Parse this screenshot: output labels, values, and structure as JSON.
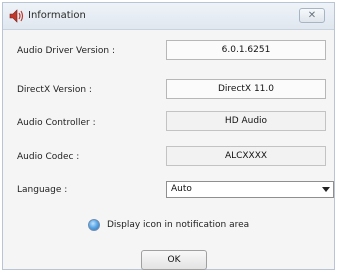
{
  "window": {
    "title": "Information",
    "close_label": "✕"
  },
  "fields": {
    "audio_driver_version": {
      "label": "Audio Driver Version :",
      "value": "6.0.1.6251"
    },
    "directx_version": {
      "label": "DirectX Version :",
      "value": "DirectX 11.0"
    },
    "audio_controller": {
      "label": "Audio Controller :",
      "value": "HD Audio"
    },
    "audio_codec": {
      "label": "Audio Codec :",
      "value": "ALCXXXX"
    }
  },
  "language": {
    "label": "Language :",
    "selected": "Auto"
  },
  "notification": {
    "label": "Display icon in notification area"
  },
  "buttons": {
    "ok_label": "OK"
  },
  "icons": {
    "title": "speaker-icon",
    "dropdown": "chevron-down-icon",
    "radio": "radio-icon"
  }
}
